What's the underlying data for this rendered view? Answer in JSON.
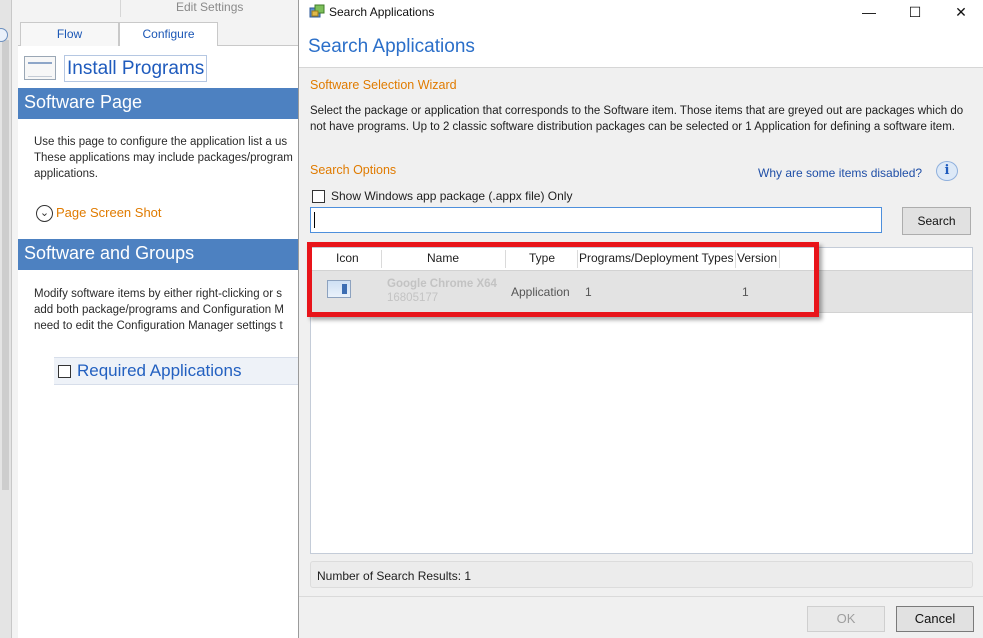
{
  "background_app": {
    "edit_settings": "Edit Settings",
    "tabs": [
      {
        "label": "Flow",
        "active": false
      },
      {
        "label": "Configure",
        "active": true
      }
    ],
    "install_programs_title": "Install Programs",
    "software_page": {
      "title": "Software Page",
      "description_lines": [
        "Use this page to configure the application list a us",
        "These applications may include packages/program",
        "applications."
      ],
      "screenshot_link": "Page Screen Shot"
    },
    "software_groups": {
      "title": "Software and Groups",
      "description_lines": [
        "Modify software items by either right-clicking or s",
        "add both package/programs and Configuration M",
        "need to edit the Configuration Manager settings t"
      ]
    },
    "required_applications": {
      "label": "Required Applications",
      "checked": false
    }
  },
  "dialog": {
    "window_title": "Search Applications",
    "controls": {
      "minimize": "—",
      "maximize": "☐",
      "close": "✕"
    },
    "header_title": "Search Applications",
    "wizard_title": "Software Selection Wizard",
    "instructions": "Select the package or application that corresponds to the Software item.  Those items that are greyed out are packages which do not have programs.  Up to 2 classic software distribution packages can be selected or 1 Application for defining a software item.",
    "search_options": {
      "title": "Search Options",
      "why_disabled_link": "Why are some items disabled?",
      "appx_only_label": "Show Windows app package (.appx file) Only",
      "appx_only_checked": false,
      "search_value": "",
      "search_button": "Search"
    },
    "results": {
      "columns": [
        "Icon",
        "Name",
        "Type",
        "Programs/Deployment Types",
        "Version"
      ],
      "rows": [
        {
          "name": "Google Chrome X64",
          "id": "16805177",
          "type": "Application",
          "programs": "1",
          "version": "1"
        }
      ],
      "count_text": "Number of Search Results: 1"
    },
    "buttons": {
      "ok": "OK",
      "ok_enabled": false,
      "cancel": "Cancel"
    },
    "highlight_color": "#e8141a",
    "accent_color": "#2b6fc9",
    "orange_color": "#e07b00"
  }
}
